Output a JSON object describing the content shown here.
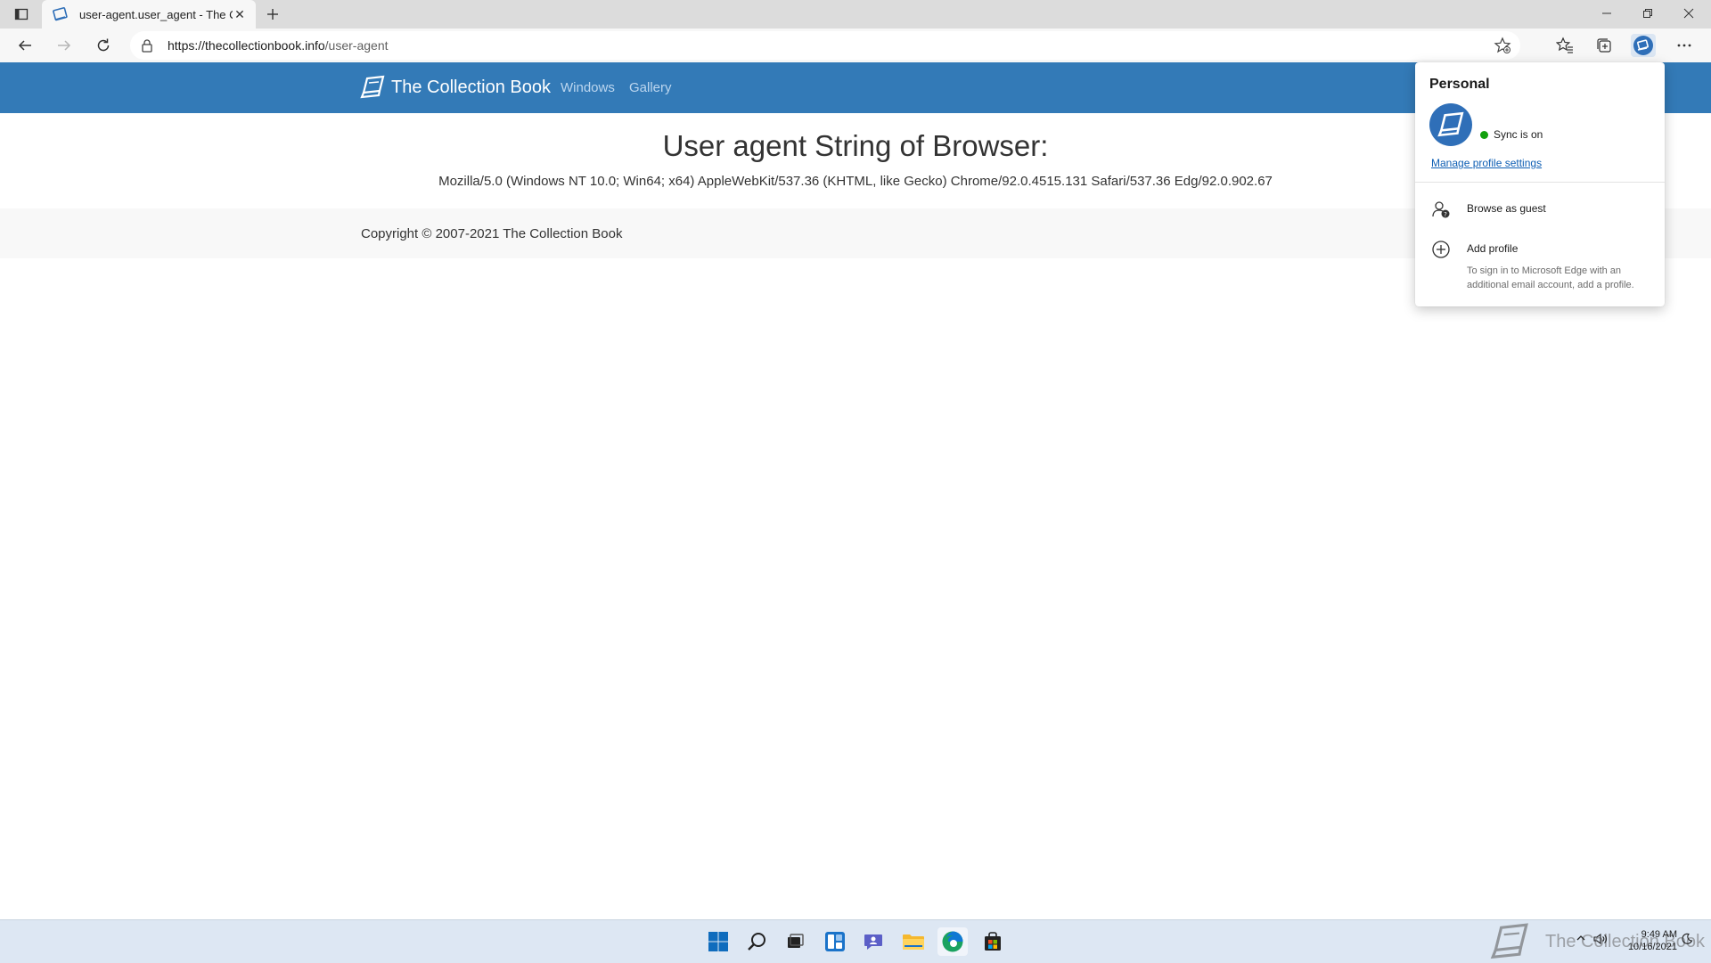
{
  "browser": {
    "tab_title": "user-agent.user_agent - The Collection Book",
    "tab_close": "✕",
    "url_scheme_host": "https://thecollectionbook.info",
    "url_path": "/user-agent"
  },
  "site": {
    "brand": "The Collection Book",
    "nav": [
      "Windows",
      "Gallery"
    ],
    "heading": "User agent String of Browser:",
    "user_agent": "Mozilla/5.0 (Windows NT 10.0; Win64; x64) AppleWebKit/537.36 (KHTML, like Gecko) Chrome/92.0.4515.131 Safari/537.36 Edg/92.0.902.67",
    "copyright": "Copyright © 2007-2021 The Collection Book"
  },
  "profile_flyout": {
    "heading": "Personal",
    "sync_status": "Sync is on",
    "manage_link": "Manage profile settings",
    "browse_guest": "Browse as guest",
    "add_profile": "Add profile",
    "add_profile_hint": "To sign in to Microsoft Edge with an additional email account, add a profile."
  },
  "taskbar": {
    "clock_time": "9:49 AM",
    "clock_date": "10/16/2021",
    "watermark": "The Collection Book"
  },
  "colors": {
    "site_nav": "#337ab7",
    "sync_dot": "#13a10e",
    "link": "#0f5fb4"
  }
}
